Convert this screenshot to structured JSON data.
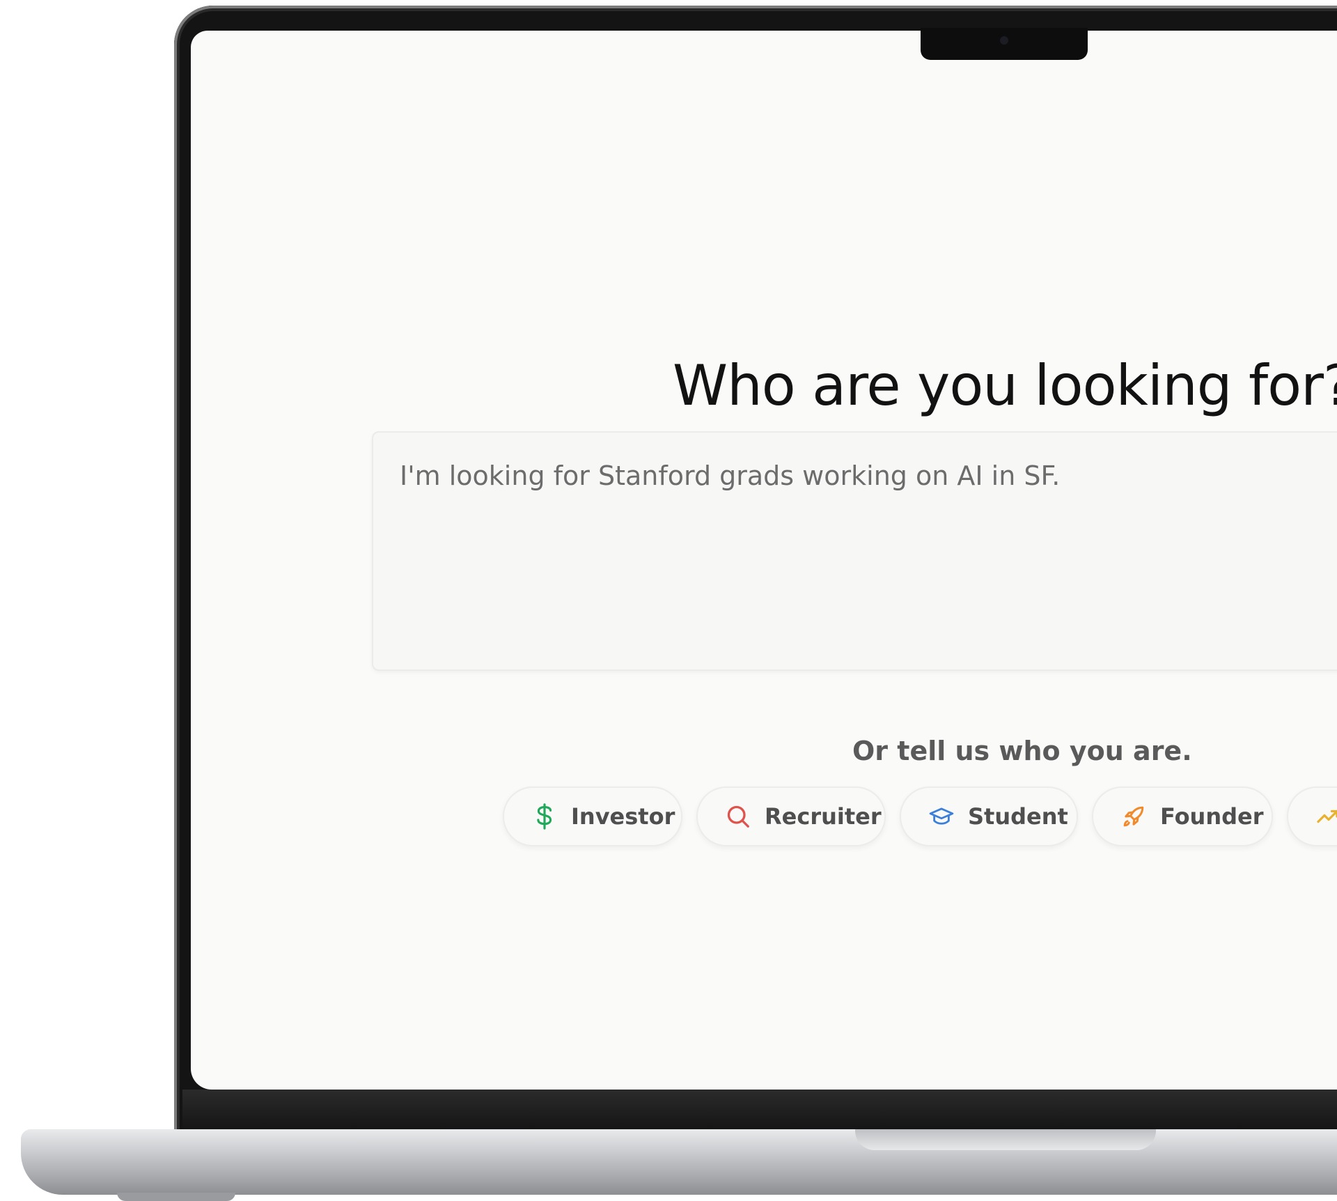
{
  "main": {
    "title": "Who are you looking for?",
    "query_placeholder": "I'm looking for Stanford grads working on AI in SF.",
    "subtitle": "Or tell us who you are."
  },
  "roles": [
    {
      "label": "Investor",
      "icon": "dollar-icon",
      "color": "#22a85a"
    },
    {
      "label": "Recruiter",
      "icon": "search-icon",
      "color": "#e0524c"
    },
    {
      "label": "Student",
      "icon": "graduation-cap-icon",
      "color": "#3b7fd9"
    },
    {
      "label": "Founder",
      "icon": "rocket-icon",
      "color": "#f08a2c"
    },
    {
      "label": "",
      "icon": "trending-up-icon",
      "color": "#e8b230"
    }
  ]
}
